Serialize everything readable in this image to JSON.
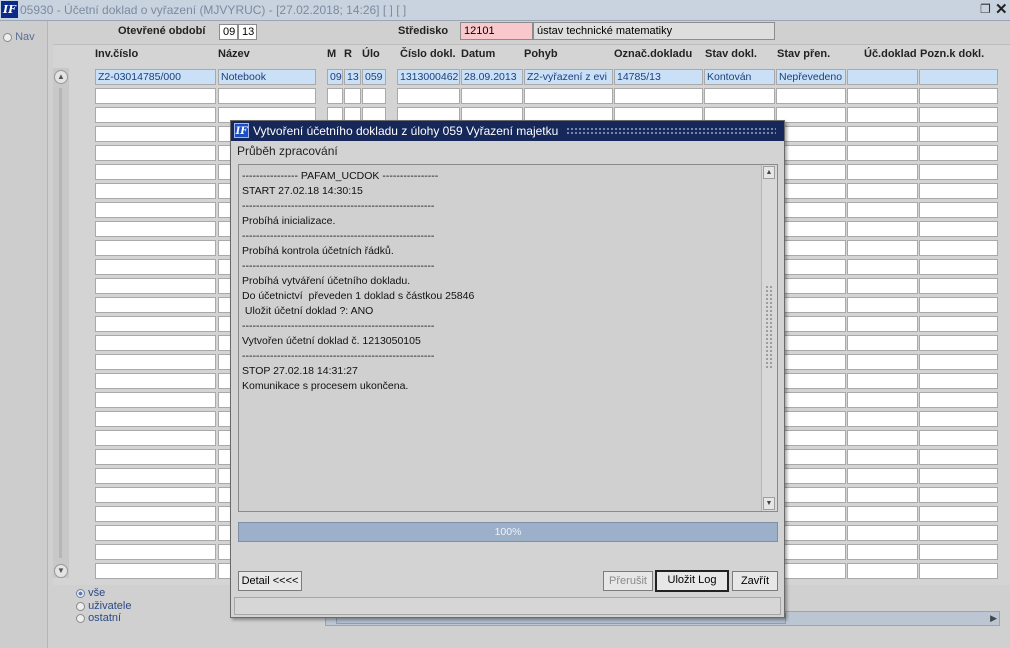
{
  "window": {
    "logo": "IF",
    "title": "05930 - Účetní doklad o vyřazení (MJVYRUC) - [27.02.2018; 14:26]  [ ]  [ ]",
    "restore_icon": "restore-icon",
    "close_icon": "close-icon"
  },
  "left_panel": {
    "nav_label": "Nav"
  },
  "header": {
    "period_label": "Otevřené období",
    "period_month": "09",
    "period_year": "13",
    "stredisko_label": "Středisko",
    "stredisko_code": "12101",
    "stredisko_name": "ústav technické matematiky"
  },
  "table": {
    "columns": [
      "Inv.číslo",
      "Název",
      "M",
      "R",
      "Úlo",
      "Číslo dokl.",
      "Datum",
      "Pohyb",
      "Označ.dokladu",
      "Stav dokl.",
      "Stav přen.",
      "Úč.doklad",
      "Pozn.k dokl."
    ],
    "rows": [
      [
        "Z2-03014785/000",
        "Notebook",
        "09",
        "13",
        "059",
        "1313000462",
        "28.09.2013",
        "Z2-vyřazení z evi",
        "14785/13",
        "Kontován",
        "Nepřevedeno",
        "",
        ""
      ]
    ]
  },
  "filter_options": {
    "all": "vše",
    "users": "uživatele",
    "others": "ostatní",
    "selected": "all"
  },
  "dialog": {
    "logo": "IF",
    "title": "Vytvoření účetního dokladu z úlohy 059 Vyřazení majetku",
    "progress_label": "Průběh zpracování",
    "log_lines": [
      "---------------- PAFAM_UCDOK ----------------",
      "START 27.02.18 14:30:15",
      "-------------------------------------------------------",
      "Probíhá inicializace.",
      "-------------------------------------------------------",
      "Probíhá kontrola účetních řádků.",
      "-------------------------------------------------------",
      "Probíhá vytváření účetního dokladu.",
      "Do účetnictví  převeden 1 doklad s částkou 25846",
      " Uložit účetní doklad ?: ANO",
      "-------------------------------------------------------",
      "Vytvořen účetní doklad č. 1213050105",
      "-------------------------------------------------------",
      "STOP 27.02.18 14:31:27",
      "Komunikace s procesem ukončena."
    ],
    "progress": 1.0,
    "progress_text": "100%",
    "buttons": {
      "detail": "Detail <<<<",
      "interrupt": "Přerušit",
      "save_log": "Uložit Log",
      "close": "Zavřít"
    }
  },
  "colors": {
    "title_bg": "#c9d3df",
    "dialog_title_bg": "#16285a",
    "selected_cell": "#c9e0f7",
    "required_field": "#f9c8cc",
    "progress_fill": "#9cb0ca"
  }
}
